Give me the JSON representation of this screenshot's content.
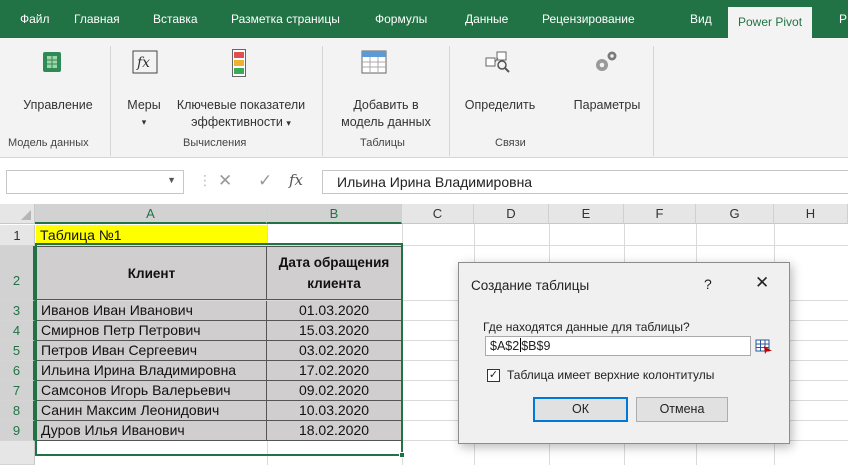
{
  "ribbon_tabs": [
    "Файл",
    "Главная",
    "Вставка",
    "Разметка страницы",
    "Формулы",
    "Данные",
    "Рецензирование",
    "Вид",
    "Power Pivot",
    "Р"
  ],
  "active_tab": "Power Pivot",
  "ribbon": {
    "buttons": {
      "manage": "Управление",
      "measures": "Меры",
      "kpi_line1": "Ключевые показатели",
      "kpi_line2": "эффективности",
      "add_line1": "Добавить в",
      "add_line2": "модель данных",
      "detect": "Определить",
      "settings": "Параметры"
    },
    "groups": {
      "data_model": "Модель данных",
      "calculations": "Вычисления",
      "tables": "Таблицы",
      "relationships": "Связи"
    }
  },
  "formula_bar": {
    "fx": "fx",
    "formula": "Ильина Ирина Владимировна"
  },
  "sheet": {
    "columns": [
      "A",
      "B",
      "C",
      "D",
      "E",
      "F",
      "G",
      "H"
    ],
    "rows": [
      "1",
      "2",
      "3",
      "4",
      "5",
      "6",
      "7",
      "8",
      "9"
    ],
    "title": "Таблица №1",
    "header": [
      "Клиент",
      "Дата обращения",
      "клиента"
    ],
    "records": [
      {
        "client": "Иванов Иван Иванович",
        "date": "01.03.2020"
      },
      {
        "client": "Смирнов Петр Петрович",
        "date": "15.03.2020"
      },
      {
        "client": "Петров Иван Сергеевич",
        "date": "03.02.2020"
      },
      {
        "client": "Ильина Ирина Владимировна",
        "date": "17.02.2020"
      },
      {
        "client": "Самсонов Игорь Валерьевич",
        "date": "09.02.2020"
      },
      {
        "client": "Санин Максим Леонидович",
        "date": "10.03.2020"
      },
      {
        "client": "Дуров Илья Иванович",
        "date": "18.02.2020"
      }
    ]
  },
  "dialog": {
    "title": "Создание таблицы",
    "help": "?",
    "close": "✕",
    "question": "Где находятся данные для таблицы?",
    "range_before_caret": "$A$2",
    "range_after_caret": "$B$9",
    "checkbox_checked": true,
    "checkbox_mark": "✓",
    "checkbox_label": "Таблица имеет верхние колонтитулы",
    "ok": "ОК",
    "cancel": "Отмена"
  },
  "colors": {
    "accent": "#217346",
    "title_fill": "#ffff00",
    "table_fill": "#d0cece",
    "focus_blue": "#0078d7"
  }
}
